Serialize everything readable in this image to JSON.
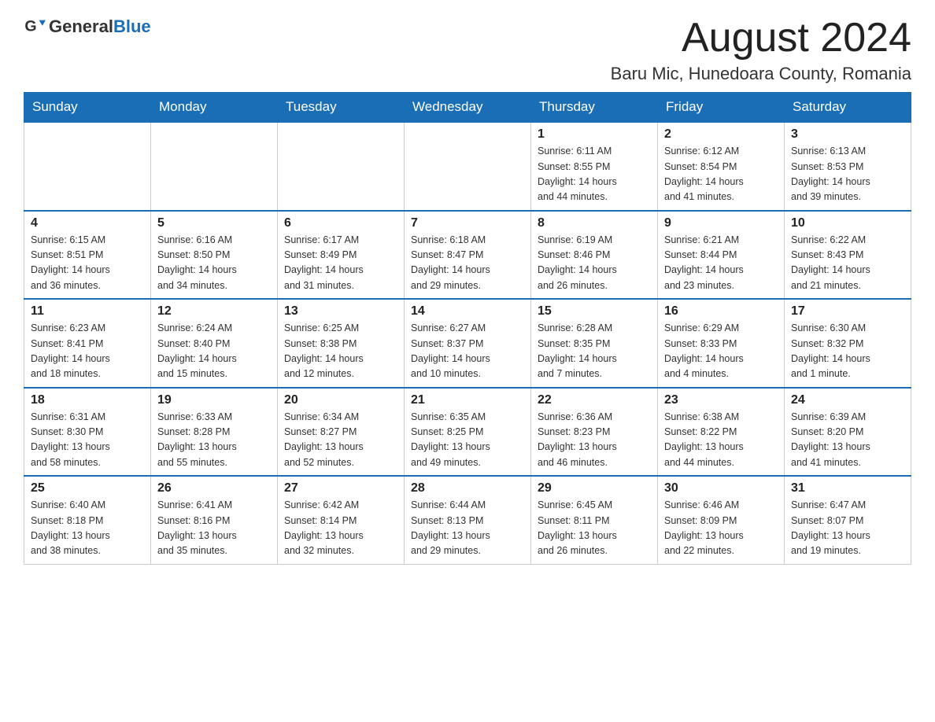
{
  "header": {
    "logo_general": "General",
    "logo_blue": "Blue",
    "month_title": "August 2024",
    "location": "Baru Mic, Hunedoara County, Romania"
  },
  "days_of_week": [
    "Sunday",
    "Monday",
    "Tuesday",
    "Wednesday",
    "Thursday",
    "Friday",
    "Saturday"
  ],
  "weeks": [
    [
      {
        "day": "",
        "info": ""
      },
      {
        "day": "",
        "info": ""
      },
      {
        "day": "",
        "info": ""
      },
      {
        "day": "",
        "info": ""
      },
      {
        "day": "1",
        "info": "Sunrise: 6:11 AM\nSunset: 8:55 PM\nDaylight: 14 hours\nand 44 minutes."
      },
      {
        "day": "2",
        "info": "Sunrise: 6:12 AM\nSunset: 8:54 PM\nDaylight: 14 hours\nand 41 minutes."
      },
      {
        "day": "3",
        "info": "Sunrise: 6:13 AM\nSunset: 8:53 PM\nDaylight: 14 hours\nand 39 minutes."
      }
    ],
    [
      {
        "day": "4",
        "info": "Sunrise: 6:15 AM\nSunset: 8:51 PM\nDaylight: 14 hours\nand 36 minutes."
      },
      {
        "day": "5",
        "info": "Sunrise: 6:16 AM\nSunset: 8:50 PM\nDaylight: 14 hours\nand 34 minutes."
      },
      {
        "day": "6",
        "info": "Sunrise: 6:17 AM\nSunset: 8:49 PM\nDaylight: 14 hours\nand 31 minutes."
      },
      {
        "day": "7",
        "info": "Sunrise: 6:18 AM\nSunset: 8:47 PM\nDaylight: 14 hours\nand 29 minutes."
      },
      {
        "day": "8",
        "info": "Sunrise: 6:19 AM\nSunset: 8:46 PM\nDaylight: 14 hours\nand 26 minutes."
      },
      {
        "day": "9",
        "info": "Sunrise: 6:21 AM\nSunset: 8:44 PM\nDaylight: 14 hours\nand 23 minutes."
      },
      {
        "day": "10",
        "info": "Sunrise: 6:22 AM\nSunset: 8:43 PM\nDaylight: 14 hours\nand 21 minutes."
      }
    ],
    [
      {
        "day": "11",
        "info": "Sunrise: 6:23 AM\nSunset: 8:41 PM\nDaylight: 14 hours\nand 18 minutes."
      },
      {
        "day": "12",
        "info": "Sunrise: 6:24 AM\nSunset: 8:40 PM\nDaylight: 14 hours\nand 15 minutes."
      },
      {
        "day": "13",
        "info": "Sunrise: 6:25 AM\nSunset: 8:38 PM\nDaylight: 14 hours\nand 12 minutes."
      },
      {
        "day": "14",
        "info": "Sunrise: 6:27 AM\nSunset: 8:37 PM\nDaylight: 14 hours\nand 10 minutes."
      },
      {
        "day": "15",
        "info": "Sunrise: 6:28 AM\nSunset: 8:35 PM\nDaylight: 14 hours\nand 7 minutes."
      },
      {
        "day": "16",
        "info": "Sunrise: 6:29 AM\nSunset: 8:33 PM\nDaylight: 14 hours\nand 4 minutes."
      },
      {
        "day": "17",
        "info": "Sunrise: 6:30 AM\nSunset: 8:32 PM\nDaylight: 14 hours\nand 1 minute."
      }
    ],
    [
      {
        "day": "18",
        "info": "Sunrise: 6:31 AM\nSunset: 8:30 PM\nDaylight: 13 hours\nand 58 minutes."
      },
      {
        "day": "19",
        "info": "Sunrise: 6:33 AM\nSunset: 8:28 PM\nDaylight: 13 hours\nand 55 minutes."
      },
      {
        "day": "20",
        "info": "Sunrise: 6:34 AM\nSunset: 8:27 PM\nDaylight: 13 hours\nand 52 minutes."
      },
      {
        "day": "21",
        "info": "Sunrise: 6:35 AM\nSunset: 8:25 PM\nDaylight: 13 hours\nand 49 minutes."
      },
      {
        "day": "22",
        "info": "Sunrise: 6:36 AM\nSunset: 8:23 PM\nDaylight: 13 hours\nand 46 minutes."
      },
      {
        "day": "23",
        "info": "Sunrise: 6:38 AM\nSunset: 8:22 PM\nDaylight: 13 hours\nand 44 minutes."
      },
      {
        "day": "24",
        "info": "Sunrise: 6:39 AM\nSunset: 8:20 PM\nDaylight: 13 hours\nand 41 minutes."
      }
    ],
    [
      {
        "day": "25",
        "info": "Sunrise: 6:40 AM\nSunset: 8:18 PM\nDaylight: 13 hours\nand 38 minutes."
      },
      {
        "day": "26",
        "info": "Sunrise: 6:41 AM\nSunset: 8:16 PM\nDaylight: 13 hours\nand 35 minutes."
      },
      {
        "day": "27",
        "info": "Sunrise: 6:42 AM\nSunset: 8:14 PM\nDaylight: 13 hours\nand 32 minutes."
      },
      {
        "day": "28",
        "info": "Sunrise: 6:44 AM\nSunset: 8:13 PM\nDaylight: 13 hours\nand 29 minutes."
      },
      {
        "day": "29",
        "info": "Sunrise: 6:45 AM\nSunset: 8:11 PM\nDaylight: 13 hours\nand 26 minutes."
      },
      {
        "day": "30",
        "info": "Sunrise: 6:46 AM\nSunset: 8:09 PM\nDaylight: 13 hours\nand 22 minutes."
      },
      {
        "day": "31",
        "info": "Sunrise: 6:47 AM\nSunset: 8:07 PM\nDaylight: 13 hours\nand 19 minutes."
      }
    ]
  ]
}
